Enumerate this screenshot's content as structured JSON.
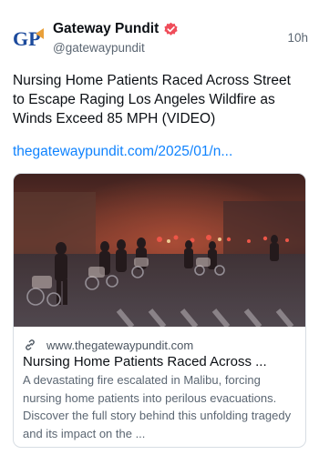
{
  "post": {
    "author": {
      "display_name": "Gateway Pundit",
      "handle": "@gatewaypundit",
      "avatar_text": "GP",
      "verified": true
    },
    "time": "10h",
    "text": "Nursing Home Patients Raced Across Street to Escape Raging Los Angeles Wildfire as Winds Exceed 85 MPH (VIDEO)",
    "link": "thegatewaypundit.com/2025/01/n..."
  },
  "card": {
    "domain": "www.thegatewaypundit.com",
    "title": "Nursing Home Patients Raced Across ...",
    "description": "A devastating fire escalated in Malibu, forcing nursing home patients into perilous evacuations. Discover the full story behind this unfolding tragedy and its impact on the ..."
  },
  "icons": {
    "verified": "verified-badge-icon",
    "link": "link-icon"
  },
  "colors": {
    "link": "#1083fe",
    "verified": "#ef4d5a",
    "avatar_text": "#1c4a9c"
  }
}
